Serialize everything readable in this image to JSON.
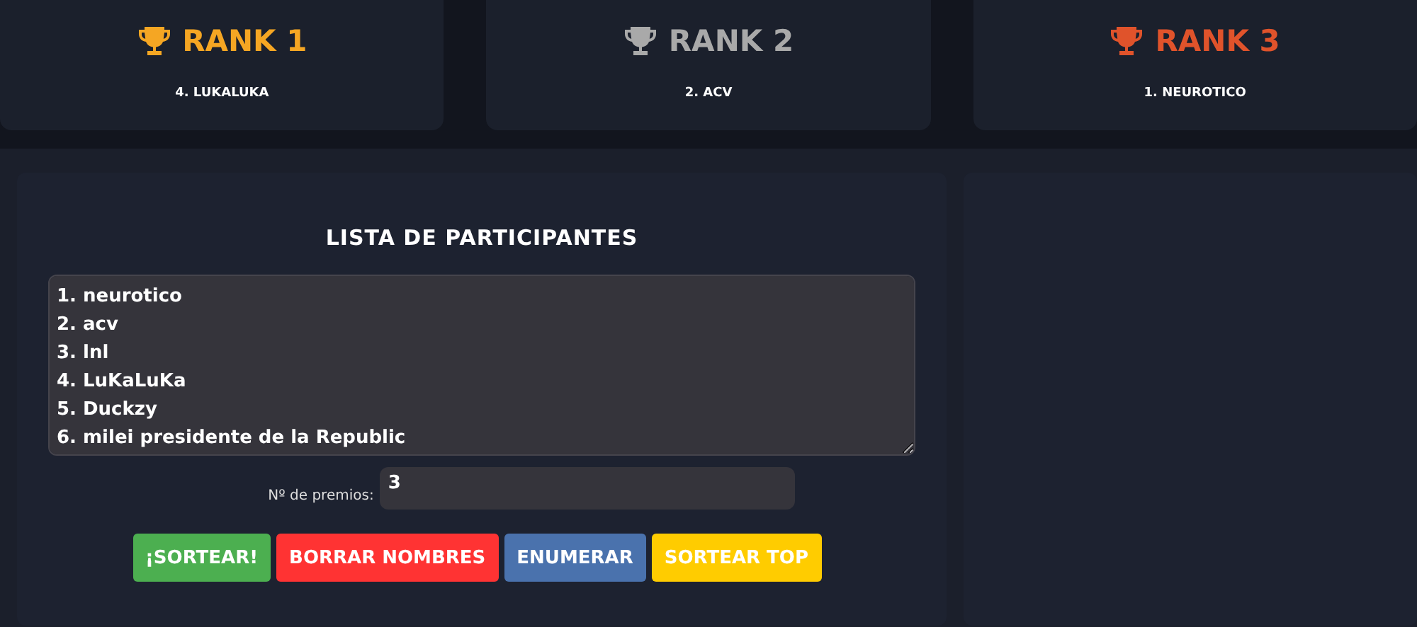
{
  "ranks": [
    {
      "title": "RANK 1",
      "winner": "4. LUKALUKA",
      "color": "#f5a623"
    },
    {
      "title": "RANK 2",
      "winner": "2. ACV",
      "color": "#a9a9a9"
    },
    {
      "title": "RANK 3",
      "winner": "1. NEUROTICO",
      "color": "#e0532b"
    }
  ],
  "participants": {
    "title": "LISTA DE PARTICIPANTES",
    "lines": [
      "1. neurotico",
      "2. acv",
      "3. lnl",
      "4. LuKaLuKa",
      "5. Duckzy",
      "6. milei presidente de la Republic"
    ]
  },
  "prizes": {
    "label": "Nº de premios:",
    "value": "3"
  },
  "buttons": [
    {
      "label": "¡SORTEAR!",
      "color": "#4caf50"
    },
    {
      "label": "BORRAR NOMBRES",
      "color": "#ff3333"
    },
    {
      "label": "ENUMERAR",
      "color": "#4a72ad"
    },
    {
      "label": "SORTEAR TOP",
      "color": "#ffcc00"
    }
  ]
}
